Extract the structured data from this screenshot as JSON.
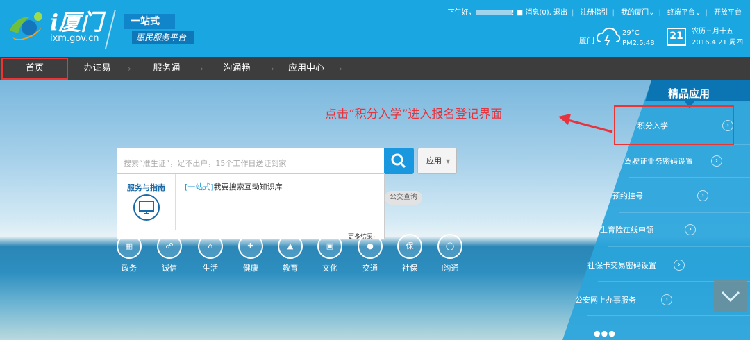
{
  "header": {
    "logo_title": "i厦门",
    "logo_url": "ixm.gov.cn",
    "slogan_1": "一站式",
    "slogan_2": "惠民服务平台",
    "greeting": "下午好，",
    "messages": "消息(0),",
    "logout": "退出",
    "register": "注册指引",
    "my_xiamen": "我的厦门",
    "terminal": "终端平台",
    "open_platform": "开放平台",
    "city": "厦门",
    "temperature": "29°C",
    "pm": "PM2.5:48",
    "calendar_day": "21",
    "lunar_date": "农历三月十五",
    "solar_date": "2016.4.21 周四"
  },
  "nav": {
    "items": [
      "首页",
      "办证易",
      "服务通",
      "沟通畅",
      "应用中心"
    ]
  },
  "search": {
    "placeholder": "搜索“准生证”，足不出户，15个工作日送证到家",
    "app_button": "应用",
    "dropdown_header": "服务与指南",
    "dropdown_item_prefix": "[一站式]",
    "dropdown_item_text": "我要搜索互动知识库",
    "more": "更多结果",
    "tag_bus": "公交查询"
  },
  "categories": [
    "政务",
    "诚信",
    "生活",
    "健康",
    "教育",
    "文化",
    "交通",
    "社保",
    "i沟通"
  ],
  "annotation": "点击“积分入学”进入报名登记界面",
  "panel": {
    "title": "精品应用",
    "items": [
      "积分入学",
      "驾驶证业务密码设置",
      "预约挂号",
      "生育险在线申领",
      "社保卡交易密码设置",
      "公安网上办事服务"
    ]
  },
  "colors": {
    "header": "#1aa6e0",
    "nav": "#3d3d3d",
    "panel": "#2aa5dc",
    "annotation": "#e8323c"
  }
}
